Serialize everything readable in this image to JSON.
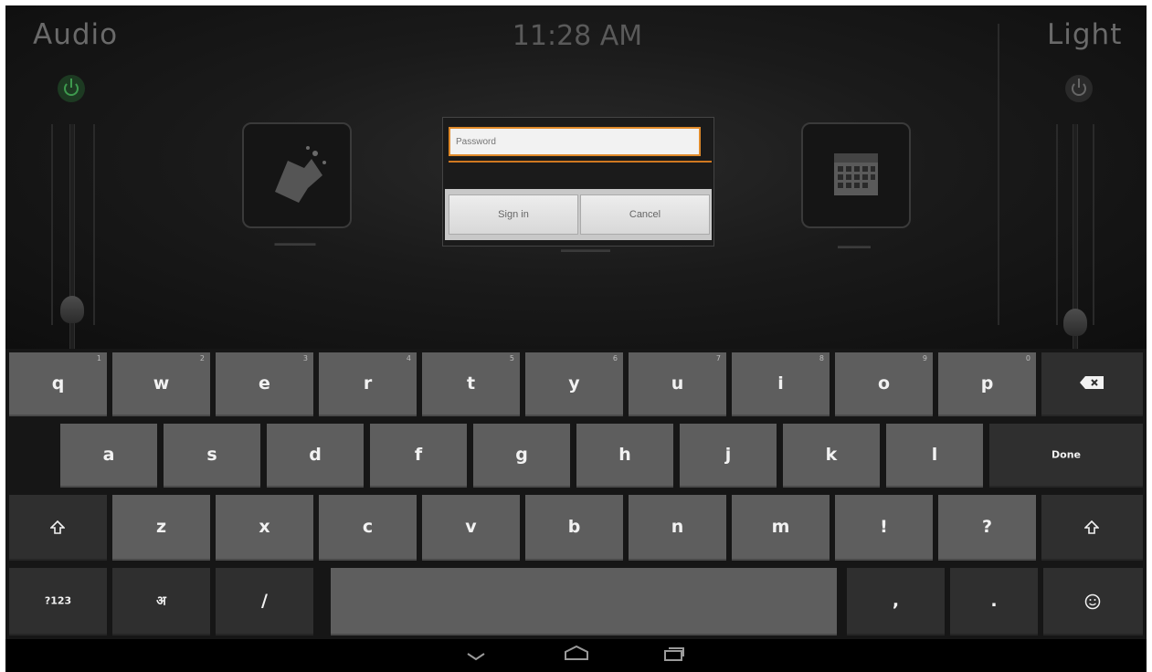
{
  "header": {
    "audio_title": "Audio",
    "light_title": "Light",
    "clock": "11:28 AM"
  },
  "colors": {
    "audio_power": "#2f7a3c",
    "light_power": "#555555",
    "input_focus": "#e08a2a"
  },
  "tiles": {
    "left_icon": "party-icon",
    "right_icon": "calendar-icon"
  },
  "dialog": {
    "password_placeholder": "Password",
    "sign_in_label": "Sign in",
    "cancel_label": "Cancel"
  },
  "keyboard": {
    "row1": [
      {
        "key": "q",
        "hint": "1"
      },
      {
        "key": "w",
        "hint": "2"
      },
      {
        "key": "e",
        "hint": "3"
      },
      {
        "key": "r",
        "hint": "4"
      },
      {
        "key": "t",
        "hint": "5"
      },
      {
        "key": "y",
        "hint": "6"
      },
      {
        "key": "u",
        "hint": "7"
      },
      {
        "key": "i",
        "hint": "8"
      },
      {
        "key": "o",
        "hint": "9"
      },
      {
        "key": "p",
        "hint": "0"
      }
    ],
    "backspace_icon": "backspace-icon",
    "row2": [
      "a",
      "s",
      "d",
      "f",
      "g",
      "h",
      "j",
      "k",
      "l"
    ],
    "done_label": "Done",
    "shift_icon": "shift-icon",
    "row3": [
      "z",
      "x",
      "c",
      "v",
      "b",
      "n",
      "m",
      "!",
      "?"
    ],
    "symbols_label": "?123",
    "lang_key": "अ",
    "slash_key": "/",
    "comma_key": ",",
    "period_key": ".",
    "emoji_icon": "emoji-icon"
  },
  "navbar": {
    "back_icon": "back-chevron-icon",
    "home_icon": "home-icon",
    "recents_icon": "recents-icon"
  }
}
